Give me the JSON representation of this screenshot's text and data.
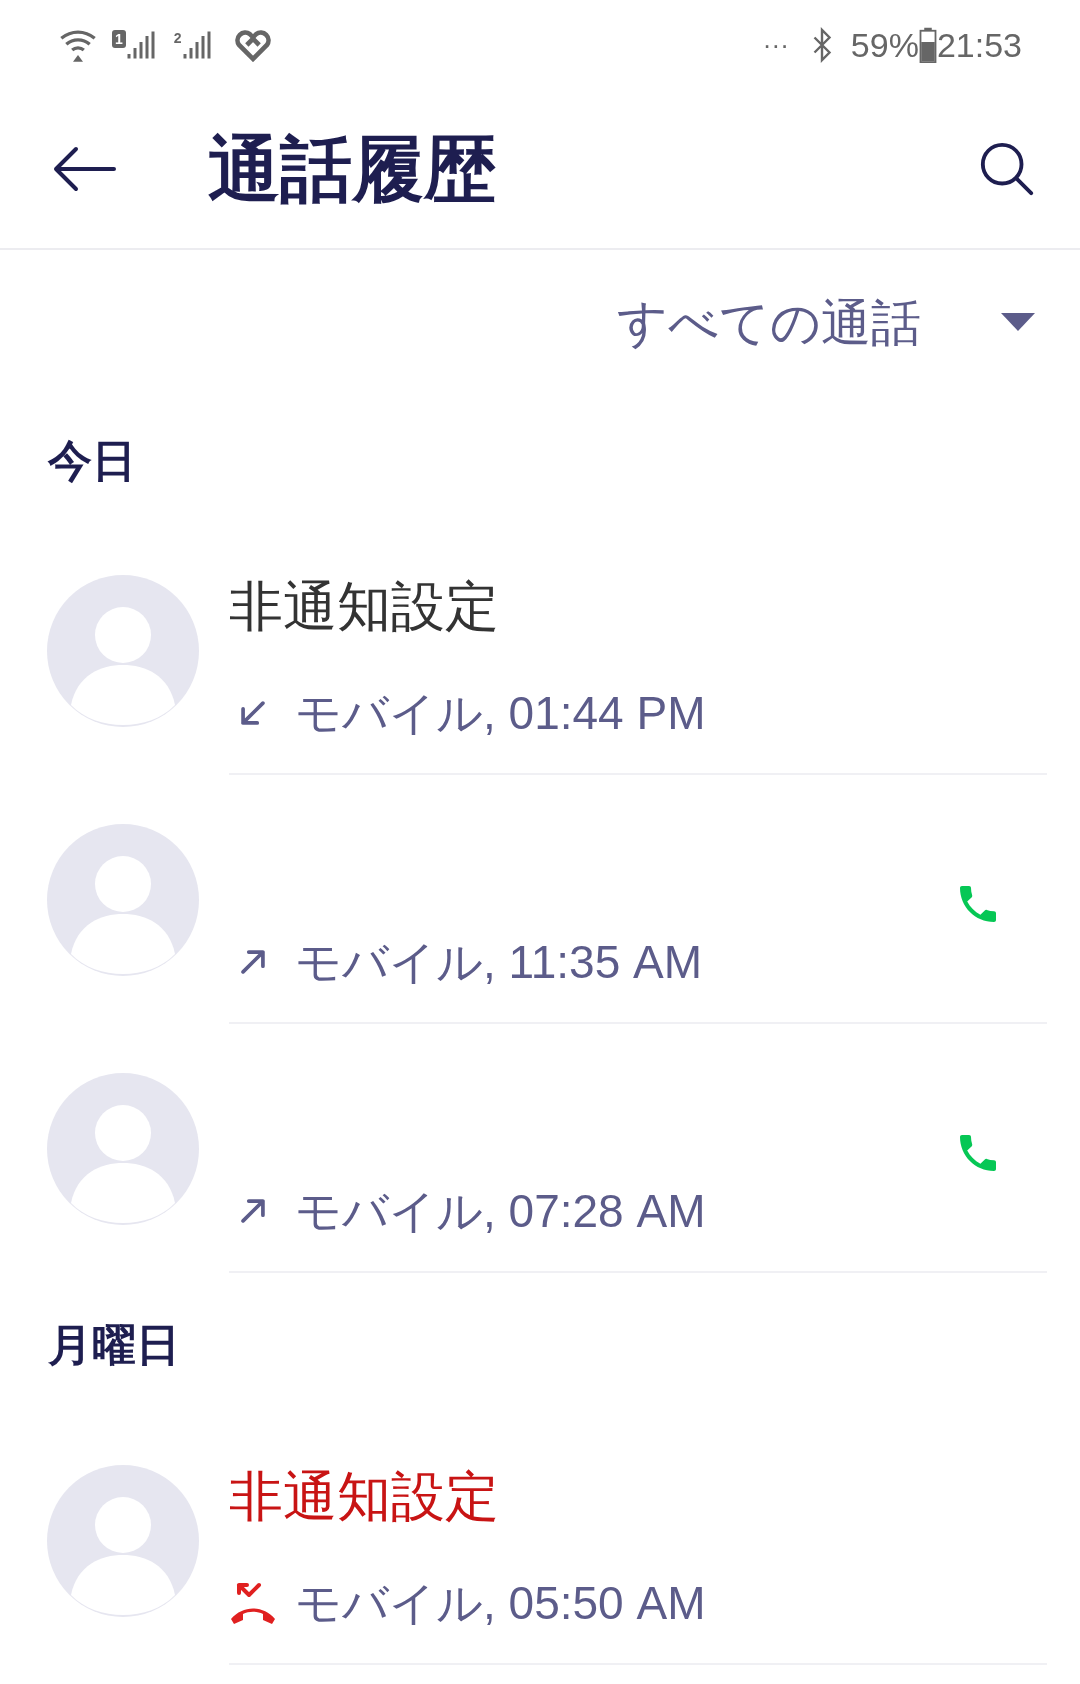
{
  "status_bar": {
    "sim1": "1",
    "sim2": "2",
    "more": "···",
    "battery": "59%",
    "time": "21:53"
  },
  "header": {
    "title": "通話履歴"
  },
  "filter": {
    "label": "すべての通話"
  },
  "sections": [
    {
      "title": "今日",
      "calls": [
        {
          "kind": "incoming",
          "name": "非通知設定",
          "detail": "モバイル, 01:44 PM",
          "call_button": false
        },
        {
          "kind": "outgoing",
          "detail": "モバイル, 11:35 AM",
          "call_button": true
        },
        {
          "kind": "outgoing",
          "detail": "モバイル, 07:28 AM",
          "call_button": true
        }
      ]
    },
    {
      "title": "月曜日",
      "calls": [
        {
          "kind": "missed",
          "name": "非通知設定",
          "detail": "モバイル, 05:50 AM",
          "call_button": false
        }
      ]
    }
  ]
}
